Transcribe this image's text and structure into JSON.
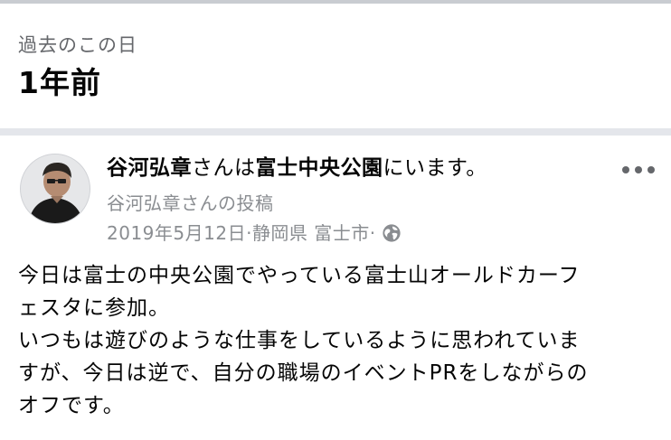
{
  "memories": {
    "kicker": "過去のこの日",
    "title": "1年前"
  },
  "post": {
    "author": "谷河弘章",
    "checkin_connector": "さんは",
    "place": "富士中央公園",
    "checkin_suffix": "にいます。",
    "byline": "谷河弘章さんの投稿",
    "date": "2019年5月12日",
    "meta_separator": " · ",
    "location": "静岡県 富士市",
    "privacy_icon": "globe-icon",
    "more_icon": "more-horizontal-icon",
    "body_lines": [
      "今日は富士の中央公園でやっている富士山オールドカーフ",
      "ェスタに参加。",
      "いつもは遊びのような仕事をしているように思われていま",
      "すが、今日は逆で、自分の職場のイベントPRをしながらの",
      "オフです。"
    ]
  },
  "colors": {
    "primary_text": "#050505",
    "secondary_text": "#65676b",
    "meta_text": "#8a8d91",
    "divider": "#e4e6eb"
  }
}
